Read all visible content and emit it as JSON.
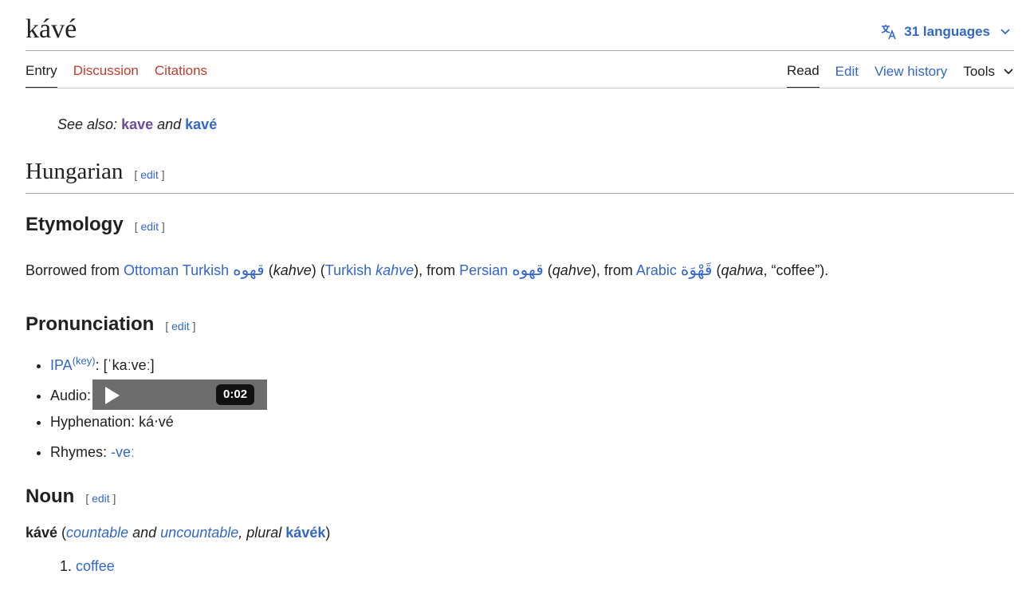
{
  "page": {
    "title": "kávé"
  },
  "languages": {
    "label": "31 languages"
  },
  "tabs_left": [
    "Entry",
    "Discussion",
    "Citations"
  ],
  "tabs_right": [
    "Read",
    "Edit",
    "View history",
    "Tools"
  ],
  "see_also": {
    "prefix": "See also: ",
    "link1": "kave",
    "and": " and ",
    "link2": "kavé"
  },
  "sections": {
    "hungarian": {
      "title": "Hungarian"
    },
    "etymology": {
      "title": "Etymology"
    },
    "pronunciation": {
      "title": "Pronunciation"
    },
    "noun": {
      "title": "Noun"
    },
    "edit_open": "[ ",
    "edit_label": "edit",
    "edit_close": " ]"
  },
  "etymology": {
    "t1": "Borrowed from ",
    "ottoman_turkish": "Ottoman Turkish",
    "ot_word": "قهوه",
    "t2": " (",
    "ot_trans": "kahve",
    "t3": ") (",
    "turkish": "Turkish",
    "t4": " ",
    "turkish_word": "kahve",
    "t5": "), from ",
    "persian": "Persian",
    "fa_word": "قهوه",
    "t6": " (",
    "fa_trans": "qahve",
    "t7": "), from ",
    "arabic": "Arabic",
    "ar_word": "قَهْوَة",
    "t8": " (",
    "ar_trans": "qahwa",
    "t9": ", “coffee”)."
  },
  "pronunciation": {
    "ipa_label": "IPA",
    "ipa_key": "(key)",
    "ipa_value": ": [ˈkaːveː]",
    "audio_label": "Audio:",
    "audio_time": "0:02",
    "hyphenation": "Hyphenation: ká‧vé",
    "rhymes_label": "Rhymes: ",
    "rhymes_value": "-veː"
  },
  "noun": {
    "headword": "kávé",
    "p1": " (",
    "countable": "countable",
    "and": " and ",
    "uncountable": "uncountable",
    "plural_label": ", plural ",
    "plural": "kávék",
    "p2": ")",
    "definitions": [
      "coffee"
    ]
  },
  "colors": {
    "link": "#3366cc",
    "red_link": "#bf3c2c",
    "visited": "#6b4ba1"
  }
}
